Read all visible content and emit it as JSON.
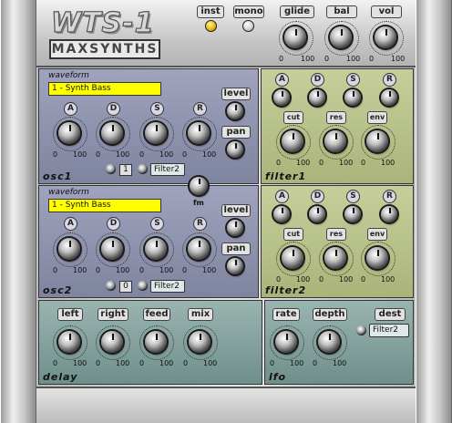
{
  "header": {
    "logo_text": "WTS-1",
    "brand_text": "MAXSYNTHS",
    "inst_label": "inst",
    "mono_label": "mono",
    "glide_label": "glide",
    "bal_label": "bal",
    "vol_label": "vol",
    "scale_min": "0",
    "scale_max": "100"
  },
  "osc1": {
    "title": "osc1",
    "waveform_label": "waveform",
    "waveform_value": "1 - Synth Bass",
    "adsr": [
      "A",
      "D",
      "S",
      "R"
    ],
    "level_label": "level",
    "pan_label": "pan",
    "filter_num": "1",
    "filter_target": "Filter2"
  },
  "osc2": {
    "title": "osc2",
    "waveform_label": "waveform",
    "waveform_value": "1 - Synth Bass",
    "adsr": [
      "A",
      "D",
      "S",
      "R"
    ],
    "level_label": "level",
    "pan_label": "pan",
    "filter_num": "0",
    "filter_target": "Filter2"
  },
  "fm_label": "fm",
  "filter1": {
    "title": "filter1",
    "adsr": [
      "A",
      "D",
      "S",
      "R"
    ],
    "cut_label": "cut",
    "res_label": "res",
    "env_label": "env"
  },
  "filter2": {
    "title": "filter2",
    "adsr": [
      "A",
      "D",
      "S",
      "R"
    ],
    "cut_label": "cut",
    "res_label": "res",
    "env_label": "env"
  },
  "delay": {
    "title": "delay",
    "left_label": "left",
    "right_label": "right",
    "feed_label": "feed",
    "mix_label": "mix"
  },
  "lfo": {
    "title": "lfo",
    "rate_label": "rate",
    "depth_label": "depth",
    "dest_label": "dest",
    "dest_value": "Filter2"
  },
  "colors": {
    "osc_panel": "#8a8fa9",
    "filter_panel": "#b9c38a",
    "bottom_panel": "#87a29e",
    "waveform_box": "#ffff00",
    "led_on": "#e7b300"
  }
}
